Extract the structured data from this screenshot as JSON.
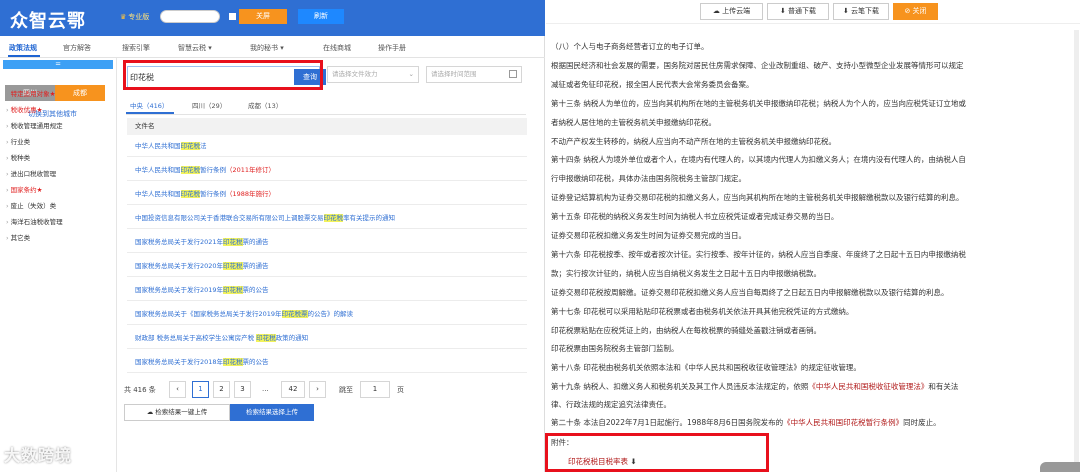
{
  "header": {
    "logo": "众智云鄂",
    "version": "专业版",
    "close_screen": "关屏",
    "refresh": "刷新"
  },
  "nav_tabs": [
    "政策法规",
    "官方解答",
    "搜索引擎",
    "智慧云税 ▾",
    "我的秘书 ▾",
    "在线商城",
    "操作手册"
  ],
  "sidebar": {
    "bar": "=",
    "cities": [
      "四川",
      "成都"
    ],
    "switch_city": "切换到其他城市",
    "items": [
      {
        "text": "特定适用对象★",
        "red": true
      },
      {
        "text": "税收优惠★",
        "red": true
      },
      {
        "text": "税收管理通用规定",
        "red": false
      },
      {
        "text": "行业类",
        "red": false
      },
      {
        "text": "税种类",
        "red": false
      },
      {
        "text": "进出口税收管理",
        "red": false
      },
      {
        "text": "国家条约★",
        "red": true
      },
      {
        "text": "废止（失效）类",
        "red": false
      },
      {
        "text": "海洋石油税收管理",
        "red": false
      },
      {
        "text": "其它类",
        "red": false
      }
    ]
  },
  "search": {
    "value": "印花税",
    "button": "查询",
    "filter1_placeholder": "请选择文件效力",
    "filter2_placeholder": "请选择时间范围"
  },
  "result_tabs": [
    "中央（416）",
    "四川（29）",
    "成都（13）"
  ],
  "table": {
    "header": "文件名",
    "rows": [
      {
        "pre": "中华人民共和国",
        "hl": "印花税",
        "post": "法",
        "red": ""
      },
      {
        "pre": "中华人民共和国",
        "hl": "印花税",
        "post": "暂行条例",
        "red": "（2011年修订）"
      },
      {
        "pre": "中华人民共和国",
        "hl": "印花税",
        "post": "暂行条例",
        "red": "（1988年施行）"
      },
      {
        "pre": "中国投资信息有限公司关于香港联合交易所有限公司上调股票交易",
        "hl": "印花税",
        "post": "率有关提示的通知",
        "red": ""
      },
      {
        "pre": "国家税务总局关于发行2021年",
        "hl": "印花税",
        "post": "票的通告",
        "red": ""
      },
      {
        "pre": "国家税务总局关于发行2020年",
        "hl": "印花税",
        "post": "票的通告",
        "red": ""
      },
      {
        "pre": "国家税务总局关于发行2019年",
        "hl": "印花税",
        "post": "票的公告",
        "red": ""
      },
      {
        "pre": "国家税务总局关于《国家税务总局关于发行2019年",
        "hl": "印花税票",
        "post": "的公告》的解读",
        "red": ""
      },
      {
        "pre": "财政部 税务总局关于高校学生公寓房产税 ",
        "hl": "印花税",
        "post": "政策的通知",
        "red": ""
      },
      {
        "pre": "国家税务总局关于发行2018年",
        "hl": "印花税",
        "post": "票的公告",
        "red": ""
      }
    ]
  },
  "pager": {
    "total": "共 416 条",
    "prev": "‹",
    "pages": [
      "1",
      "2",
      "3",
      "...",
      "42"
    ],
    "next": "›",
    "goto_label": "跳至",
    "goto_value": "1",
    "page_unit": "页"
  },
  "actions": {
    "upload_all": "检索结果一键上传",
    "upload_selected": "检索结果选择上传"
  },
  "doc_toolbar": {
    "upload_cloud": "上传云端",
    "normal_download": "普通下载",
    "cloud_download": "云笔下载",
    "close": "关闭"
  },
  "doc": {
    "lines": [
      "（八）个人与电子商务经营者订立的电子订单。",
      "根据国民经济和社会发展的需要，国务院对居民住房需求保障、企业改制重组、破产、支持小型微型企业发展等情形可以规定",
      "减征或者免征印花税，报全国人民代表大会常务委员会备案。",
      "第十三条 纳税人为单位的，应当向其机构所在地的主管税务机关申报缴纳印花税；纳税人为个人的，应当向应税凭证订立地或",
      "者纳税人居住地的主管税务机关申报缴纳印花税。",
      "不动产产权发生转移的，纳税人应当向不动产所在地的主管税务机关申报缴纳印花税。",
      "第十四条 纳税人为境外单位或者个人，在境内有代理人的，以其境内代理人为扣缴义务人；在境内没有代理人的，由纳税人自",
      "行申报缴纳印花税，具体办法由国务院税务主管部门规定。",
      "证券登记结算机构为证券交易印花税的扣缴义务人，应当向其机构所在地的主管税务机关申报解缴税款以及银行结算的利息。",
      "第十五条 印花税的纳税义务发生时间为纳税人书立应税凭证或者完成证券交易的当日。",
      "证券交易印花税扣缴义务发生时间为证券交易完成的当日。",
      "第十六条 印花税按季、按年或者按次计征。实行按季、按年计征的，纳税人应当自季度、年度终了之日起十五日内申报缴纳税",
      "款；实行按次计征的，纳税人应当自纳税义务发生之日起十五日内申报缴纳税款。",
      "证券交易印花税按周解缴。证券交易印花税扣缴义务人应当自每周终了之日起五日内申报解缴税款以及银行结算的利息。",
      "第十七条 印花税可以采用粘贴印花税票或者由税务机关依法开具其他完税凭证的方式缴纳。",
      "印花税票粘贴在应税凭证上的，由纳税人在每枚税票的骑缝处盖戳注销或者画销。",
      "印花税票由国务院税务主管部门监制。",
      "第十八条 印花税由税务机关依照本法和《中华人民共和国税收征收管理法》的规定征收管理。"
    ],
    "line19_pre": "第十九条 纳税人、扣缴义务人和税务机关及其工作人员违反本法规定的，依照",
    "line19_link": "《中华人民共和国税收征收管理法》",
    "line19_post": "和有关法",
    "line20": "律、行政法规的规定追究法律责任。",
    "line21_pre": "第二十条 本法自2022年7月1日起施行。1988年8月6日国务院发布的",
    "line21_link": "《中华人民共和国印花税暂行条例》",
    "line21_post": "同时废止。",
    "attachment_label": "附件：",
    "attachment_link": "印花税税目税率表"
  },
  "watermark": "大数跨境"
}
